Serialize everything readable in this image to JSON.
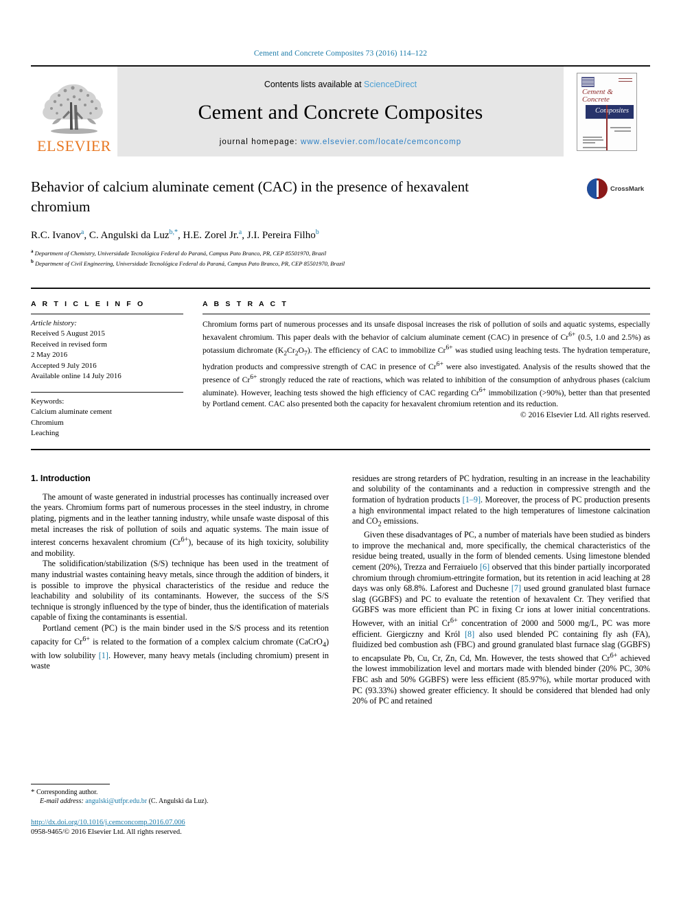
{
  "running_head": "Cement and Concrete Composites 73 (2016) 114–122",
  "masthead": {
    "publisher_name": "ELSEVIER",
    "contents_prefix": "Contents lists available at ",
    "contents_link": "ScienceDirect",
    "journal_title": "Cement and Concrete Composites",
    "homepage_label": "journal homepage: ",
    "homepage_url": "www.elsevier.com/locate/cemconcomp",
    "cover": {
      "line1": "Cement &",
      "line2": "Concrete",
      "line3": "Composites"
    }
  },
  "article": {
    "title": "Behavior of calcium aluminate cement (CAC) in the presence of hexavalent chromium",
    "authors_html": "R.C. Ivanov a, C. Angulski da Luz b,*, H.E. Zorel Jr. a, J.I. Pereira Filho b",
    "authors": [
      {
        "name": "R.C. Ivanov",
        "sup": "a"
      },
      {
        "name": "C. Angulski da Luz",
        "sup": "b,*"
      },
      {
        "name": "H.E. Zorel Jr.",
        "sup": "a"
      },
      {
        "name": "J.I. Pereira Filho",
        "sup": "b"
      }
    ],
    "affiliations": [
      {
        "sup": "a",
        "text": "Department of Chemistry, Universidade Tecnológica Federal do Paraná, Campus Pato Branco, PR, CEP 85501970, Brazil"
      },
      {
        "sup": "b",
        "text": "Department of Civil Engineering, Universidade Tecnológica Federal do Paraná, Campus Pato Branco, PR, CEP 85501970, Brazil"
      }
    ],
    "crossmark_label": "CrossMark"
  },
  "article_info": {
    "heading": "A R T I C L E  I N F O",
    "history_label": "Article history:",
    "history": [
      "Received 5 August 2015",
      "Received in revised form",
      "2 May 2016",
      "Accepted 9 July 2016",
      "Available online 14 July 2016"
    ],
    "keywords_label": "Keywords:",
    "keywords": [
      "Calcium aluminate cement",
      "Chromium",
      "Leaching"
    ]
  },
  "abstract": {
    "heading": "A B S T R A C T",
    "text": "Chromium forms part of numerous processes and its unsafe disposal increases the risk of pollution of soils and aquatic systems, especially hexavalent chromium. This paper deals with the behavior of calcium aluminate cement (CAC) in presence of Cr6+ (0.5, 1.0 and 2.5%) as potassium dichromate (K2Cr2O7). The efficiency of CAC to immobilize Cr6+ was studied using leaching tests. The hydration temperature, hydration products and compressive strength of CAC in presence of Cr6+ were also investigated. Analysis of the results showed that the presence of Cr6+ strongly reduced the rate of reactions, which was related to inhibition of the consumption of anhydrous phases (calcium aluminate). However, leaching tests showed the high efficiency of CAC regarding Cr6+ immobilization (>90%), better than that presented by Portland cement. CAC also presented both the capacity for hexavalent chromium retention and its reduction.",
    "copyright": "© 2016 Elsevier Ltd. All rights reserved."
  },
  "body": {
    "section_number_title": "1. Introduction",
    "left_paragraphs": [
      "The amount of waste generated in industrial processes has continually increased over the years. Chromium forms part of numerous processes in the steel industry, in chrome plating, pigments and in the leather tanning industry, while unsafe waste disposal of this metal increases the risk of pollution of soils and aquatic systems. The main issue of interest concerns hexavalent chromium (Cr6+), because of its high toxicity, solubility and mobility.",
      "The solidification/stabilization (S/S) technique has been used in the treatment of many industrial wastes containing heavy metals, since through the addition of binders, it is possible to improve the physical characteristics of the residue and reduce the leachability and solubility of its contaminants. However, the success of the S/S technique is strongly influenced by the type of binder, thus the identification of materials capable of fixing the contaminants is essential.",
      "Portland cement (PC) is the main binder used in the S/S process and its retention capacity for Cr6+ is related to the formation of a complex calcium chromate (CaCrO4) with low solubility [1]. However, many heavy metals (including chromium) present in waste"
    ],
    "right_paragraphs": [
      "residues are strong retarders of PC hydration, resulting in an increase in the leachability and solubility of the contaminants and a reduction in compressive strength and the formation of hydration products [1–9]. Moreover, the process of PC production presents a high environmental impact related to the high temperatures of limestone calcination and CO2 emissions.",
      "Given these disadvantages of PC, a number of materials have been studied as binders to improve the mechanical and, more specifically, the chemical characteristics of the residue being treated, usually in the form of blended cements. Using limestone blended cement (20%), Trezza and Ferraiuelo [6] observed that this binder partially incorporated chromium through chromium-ettringite formation, but its retention in acid leaching at 28 days was only 68.8%. Laforest and Duchesne [7] used ground granulated blast furnace slag (GGBFS) and PC to evaluate the retention of hexavalent Cr. They verified that GGBFS was more efficient than PC in fixing Cr ions at lower initial concentrations. However, with an initial Cr6+ concentration of 2000 and 5000 mg/L, PC was more efficient. Giergiczny and Król [8] also used blended PC containing fly ash (FA), fluidized bed combustion ash (FBC) and ground granulated blast furnace slag (GGBFS) to encapsulate Pb, Cu, Cr, Zn, Cd, Mn. However, the tests showed that Cr6+ achieved the lowest immobilization level and mortars made with blended binder (20% PC, 30% FBC ash and 50% GGBFS) were less efficient (85.97%), while mortar produced with PC (93.33%) showed greater efficiency. It should be considered that blended had only 20% of PC and retained"
    ]
  },
  "footnotes": {
    "corresponding_marker": "*",
    "corresponding_label": "Corresponding author.",
    "email_label": "E-mail address:",
    "email": "angulski@utfpr.edu.br",
    "email_owner": "(C. Angulski da Luz).",
    "doi_url": "http://dx.doi.org/10.1016/j.cemconcomp.2016.07.006",
    "issn_line": "0958-9465/© 2016 Elsevier Ltd. All rights reserved."
  },
  "colors": {
    "link_blue": "#1a7aa8",
    "elsevier_orange": "#E87722",
    "cover_red": "#8e2b2b",
    "cover_navy": "#27336b"
  }
}
